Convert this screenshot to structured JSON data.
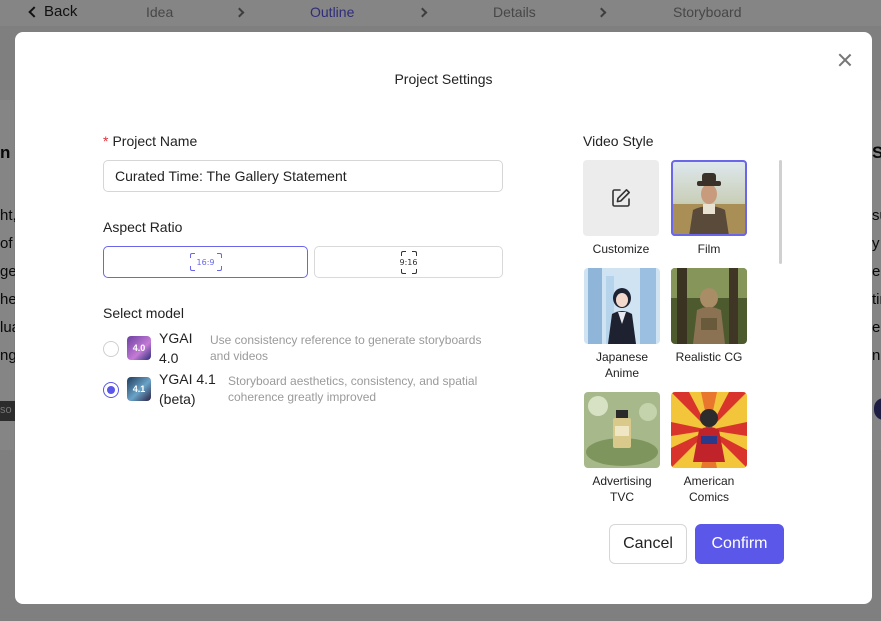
{
  "nav": {
    "back_label": "Back",
    "steps": [
      "Idea",
      "Outline",
      "Details",
      "Storyboard"
    ],
    "active_step": "Outline"
  },
  "background_fragments": {
    "left": [
      "n T",
      "ht,",
      "of a",
      "ge",
      "her",
      "lua",
      "ng"
    ],
    "right": [
      "S",
      "su",
      "y",
      "e",
      "tin",
      "e",
      "n"
    ],
    "tag": "so"
  },
  "modal": {
    "title": "Project Settings",
    "project_name": {
      "label": "Project Name",
      "required_mark": "*",
      "value": "Curated Time: The Gallery Statement"
    },
    "aspect_ratio": {
      "label": "Aspect Ratio",
      "options": [
        "16:9",
        "9:16"
      ],
      "selected": "16:9"
    },
    "model": {
      "label": "Select model",
      "options": [
        {
          "thumb": "4.0",
          "name": "YGAI 4.0",
          "description": "Use consistency reference to generate storyboards and videos",
          "selected": false
        },
        {
          "thumb": "4.1",
          "name": "YGAI 4.1 (beta)",
          "description": "Storyboard aesthetics, consistency, and spatial coherence greatly improved",
          "selected": true
        }
      ]
    },
    "video_style": {
      "label": "Video Style",
      "options": [
        {
          "name": "Customize",
          "icon": "edit-icon",
          "selected": false
        },
        {
          "name": "Film",
          "selected": true
        },
        {
          "name": "Japanese Anime",
          "selected": false
        },
        {
          "name": "Realistic CG",
          "selected": false
        },
        {
          "name": "Advertising TVC",
          "selected": false
        },
        {
          "name": "American Comics",
          "selected": false
        }
      ]
    },
    "buttons": {
      "cancel": "Cancel",
      "confirm": "Confirm"
    }
  },
  "colors": {
    "accent": "#5b57e8",
    "required": "#e0303a",
    "overlay": "rgba(0,0,0,0.48)"
  }
}
